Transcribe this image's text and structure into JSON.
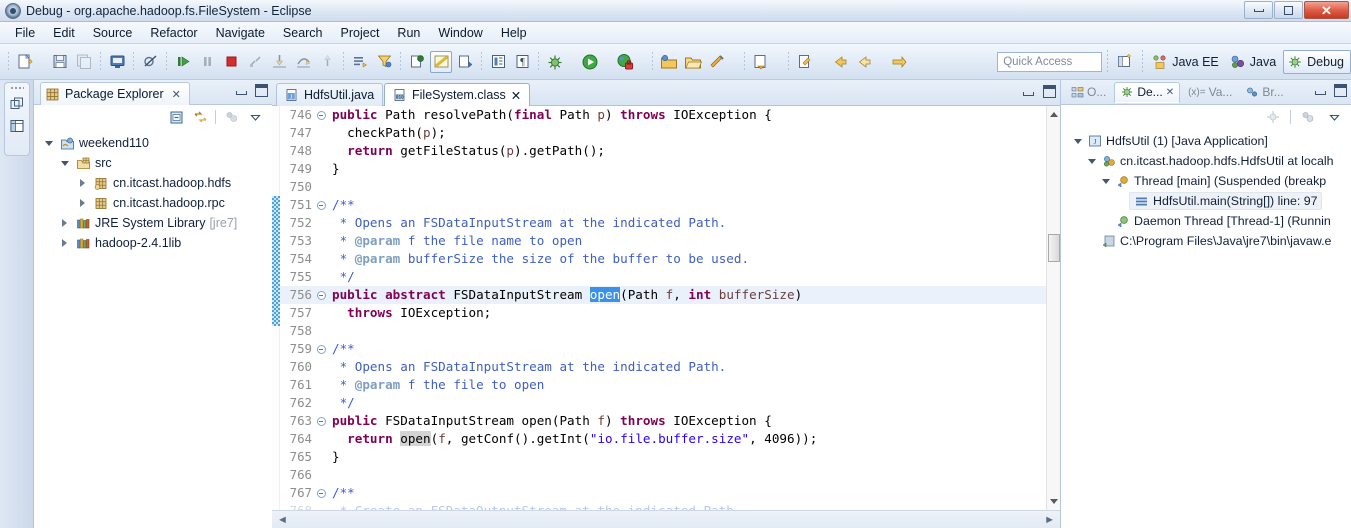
{
  "window": {
    "title": "Debug - org.apache.hadoop.fs.FileSystem - Eclipse",
    "app_icon": "eclipse-icon",
    "minimize_label": "Minimize",
    "restore_label": "Restore",
    "close_label": "Close"
  },
  "menu": {
    "items": [
      {
        "label": "File"
      },
      {
        "label": "Edit"
      },
      {
        "label": "Source"
      },
      {
        "label": "Refactor"
      },
      {
        "label": "Navigate"
      },
      {
        "label": "Search"
      },
      {
        "label": "Project"
      },
      {
        "label": "Run"
      },
      {
        "label": "Window"
      },
      {
        "label": "Help"
      }
    ]
  },
  "toolbar": {
    "icons": [
      "new-wizard-icon",
      "new-dropdown-icon",
      "save-icon",
      "save-all-icon",
      "print-icon",
      "toggle-breakpoint-icon",
      "resume-icon",
      "suspend-icon",
      "terminate-icon",
      "disconnect-icon",
      "step-into-icon",
      "step-over-icon",
      "step-return-icon",
      "drop-to-frame-icon",
      "use-step-filters-icon",
      "skip-all-breakpoints-icon",
      "toggle-mark-occurrences-icon",
      "open-type-icon",
      "toggle-block-selection-icon",
      "show-whitespace-icon",
      "debug-icon",
      "debug-dropdown-icon",
      "run-icon",
      "run-dropdown-icon",
      "coverage-icon",
      "coverage-dropdown-icon",
      "new-java-project-icon",
      "open-folder-icon",
      "external-tools-icon",
      "external-tools-dropdown-icon",
      "search-icon",
      "search-dropdown-icon",
      "last-edit-location-icon",
      "last-edit-dropdown-icon",
      "back-icon",
      "forward-icon",
      "forward-dropdown-icon",
      "next-annotation-icon",
      "next-annotation-dropdown-icon"
    ],
    "quick_access_placeholder": "Quick Access",
    "open-perspective-icon": "open-perspective-icon",
    "perspectives": [
      {
        "label": "Java EE",
        "icon": "java-ee-perspective-icon",
        "active": false
      },
      {
        "label": "Java",
        "icon": "java-perspective-icon",
        "active": false
      },
      {
        "label": "Debug",
        "icon": "debug-perspective-icon",
        "active": true
      }
    ]
  },
  "left_strip": {
    "icons": [
      "restore-view-icon",
      "package-explorer-fastview-icon"
    ]
  },
  "package_explorer": {
    "tab_label": "Package Explorer",
    "tab_icon": "package-explorer-icon",
    "close_glyph": "✕",
    "toolbar_icons": [
      "collapse-all-icon",
      "link-with-editor-icon",
      "focus-on-active-task-icon",
      "view-menu-icon"
    ],
    "tree": [
      {
        "label": "weekend110",
        "icon": "java-project-icon",
        "indent": 0,
        "twisty": "open"
      },
      {
        "label": "src",
        "icon": "source-folder-icon",
        "indent": 1,
        "twisty": "open"
      },
      {
        "label": "cn.itcast.hadoop.hdfs",
        "icon": "package-icon",
        "indent": 2,
        "twisty": "closed"
      },
      {
        "label": "cn.itcast.hadoop.rpc",
        "icon": "package-icon",
        "indent": 2,
        "twisty": "closed"
      },
      {
        "label": "JRE System Library",
        "suffix": "[jre7]",
        "icon": "library-icon",
        "indent": 1,
        "twisty": "closed"
      },
      {
        "label": "hadoop-2.4.1lib",
        "icon": "library-icon",
        "indent": 1,
        "twisty": "closed"
      }
    ]
  },
  "editor": {
    "tabs": [
      {
        "label": "HdfsUtil.java",
        "icon": "java-file-icon",
        "active": false,
        "closable": false
      },
      {
        "label": "FileSystem.class",
        "icon": "class-file-icon",
        "active": true,
        "closable": true,
        "close_glyph": "✕"
      }
    ],
    "controls": [
      "minimize-icon",
      "maximize-icon"
    ],
    "scroll": {
      "up_glyph": "▲",
      "down_glyph": "▼",
      "left_glyph": "◄",
      "right_glyph": "►"
    },
    "lines": [
      {
        "no": "746",
        "fold": true,
        "indent": 1,
        "tokens": [
          {
            "t": "public ",
            "c": "kw"
          },
          {
            "t": "Path resolvePath(",
            "c": ""
          },
          {
            "t": "final",
            "c": "kw"
          },
          {
            "t": " Path ",
            "c": ""
          },
          {
            "t": "p",
            "c": "par"
          },
          {
            "t": ") ",
            "c": ""
          },
          {
            "t": "throws",
            "c": "kw"
          },
          {
            "t": " IOException {",
            "c": ""
          }
        ]
      },
      {
        "no": "747",
        "fold": false,
        "indent": 1,
        "tokens": [
          {
            "t": "  checkPath(",
            "c": ""
          },
          {
            "t": "p",
            "c": "par"
          },
          {
            "t": ");",
            "c": ""
          }
        ]
      },
      {
        "no": "748",
        "fold": false,
        "indent": 1,
        "tokens": [
          {
            "t": "  ",
            "c": ""
          },
          {
            "t": "return",
            "c": "kw"
          },
          {
            "t": " getFileStatus(",
            "c": ""
          },
          {
            "t": "p",
            "c": "par"
          },
          {
            "t": ").getPath();",
            "c": ""
          }
        ]
      },
      {
        "no": "749",
        "fold": false,
        "indent": 1,
        "tokens": [
          {
            "t": "}",
            "c": ""
          }
        ]
      },
      {
        "no": "750",
        "fold": false,
        "indent": 1,
        "tokens": []
      },
      {
        "no": "751",
        "fold": true,
        "indent": 1,
        "tokens": [
          {
            "t": "/**",
            "c": "cmt"
          }
        ]
      },
      {
        "no": "752",
        "fold": false,
        "indent": 1,
        "tokens": [
          {
            "t": " * Opens an FSDataInputStream at the indicated Path.",
            "c": "cmt"
          }
        ]
      },
      {
        "no": "753",
        "fold": false,
        "indent": 1,
        "tokens": [
          {
            "t": " * ",
            "c": "cmt"
          },
          {
            "t": "@param",
            "c": "cmtk"
          },
          {
            "t": " f the file name to open",
            "c": "cmt"
          }
        ]
      },
      {
        "no": "754",
        "fold": false,
        "indent": 1,
        "tokens": [
          {
            "t": " * ",
            "c": "cmt"
          },
          {
            "t": "@param",
            "c": "cmtk"
          },
          {
            "t": " bufferSize the size of the buffer to be used.",
            "c": "cmt"
          }
        ]
      },
      {
        "no": "755",
        "fold": false,
        "indent": 1,
        "tokens": [
          {
            "t": " */",
            "c": "cmt"
          }
        ]
      },
      {
        "no": "756",
        "fold": true,
        "indent": 1,
        "highlight": true,
        "tokens": [
          {
            "t": "public abstract",
            "c": "kw"
          },
          {
            "t": " FSDataInputStream ",
            "c": ""
          },
          {
            "t": "open",
            "c": "sel"
          },
          {
            "t": "(Path ",
            "c": ""
          },
          {
            "t": "f",
            "c": "par"
          },
          {
            "t": ", ",
            "c": ""
          },
          {
            "t": "int",
            "c": "kw"
          },
          {
            "t": " ",
            "c": ""
          },
          {
            "t": "bufferSize",
            "c": "par"
          },
          {
            "t": ")",
            "c": ""
          }
        ]
      },
      {
        "no": "757",
        "fold": false,
        "indent": 1,
        "tokens": [
          {
            "t": "  ",
            "c": ""
          },
          {
            "t": "throws",
            "c": "kw"
          },
          {
            "t": " IOException;",
            "c": ""
          }
        ]
      },
      {
        "no": "758",
        "fold": false,
        "indent": 1,
        "tokens": []
      },
      {
        "no": "759",
        "fold": true,
        "indent": 1,
        "tokens": [
          {
            "t": "/**",
            "c": "cmt"
          }
        ]
      },
      {
        "no": "760",
        "fold": false,
        "indent": 1,
        "tokens": [
          {
            "t": " * Opens an FSDataInputStream at the indicated Path.",
            "c": "cmt"
          }
        ]
      },
      {
        "no": "761",
        "fold": false,
        "indent": 1,
        "tokens": [
          {
            "t": " * ",
            "c": "cmt"
          },
          {
            "t": "@param",
            "c": "cmtk"
          },
          {
            "t": " f the file to open",
            "c": "cmt"
          }
        ]
      },
      {
        "no": "762",
        "fold": false,
        "indent": 1,
        "tokens": [
          {
            "t": " */",
            "c": "cmt"
          }
        ]
      },
      {
        "no": "763",
        "fold": true,
        "indent": 1,
        "tokens": [
          {
            "t": "public",
            "c": "kw"
          },
          {
            "t": " FSDataInputStream open(Path ",
            "c": ""
          },
          {
            "t": "f",
            "c": "par"
          },
          {
            "t": ") ",
            "c": ""
          },
          {
            "t": "throws",
            "c": "kw"
          },
          {
            "t": " IOException {",
            "c": ""
          }
        ]
      },
      {
        "no": "764",
        "fold": false,
        "indent": 1,
        "tokens": [
          {
            "t": "  ",
            "c": ""
          },
          {
            "t": "return",
            "c": "kw"
          },
          {
            "t": " ",
            "c": ""
          },
          {
            "t": "open",
            "c": "occ"
          },
          {
            "t": "(",
            "c": ""
          },
          {
            "t": "f",
            "c": "par"
          },
          {
            "t": ", getConf().getInt(",
            "c": ""
          },
          {
            "t": "\"io.file.buffer.size\"",
            "c": "str"
          },
          {
            "t": ", 4096));",
            "c": ""
          }
        ]
      },
      {
        "no": "765",
        "fold": false,
        "indent": 1,
        "tokens": [
          {
            "t": "}",
            "c": ""
          }
        ]
      },
      {
        "no": "766",
        "fold": false,
        "indent": 1,
        "tokens": []
      },
      {
        "no": "767",
        "fold": true,
        "indent": 1,
        "tokens": [
          {
            "t": "/**",
            "c": "cmt"
          }
        ]
      },
      {
        "no": "768",
        "fold": false,
        "indent": 1,
        "clipped": true,
        "tokens": [
          {
            "t": " * Create an FSDataOutputStream at the indicated Path.",
            "c": "cmt"
          }
        ]
      }
    ]
  },
  "debug_view": {
    "tabs": [
      {
        "label": "O...",
        "icon": "outline-icon",
        "active": false
      },
      {
        "label": "De...",
        "icon": "debug-icon",
        "active": true,
        "closable": true,
        "close_glyph": "✕"
      },
      {
        "label": "Va...",
        "icon": "variables-icon",
        "prefix": "(x)=",
        "active": false
      },
      {
        "label": "Br...",
        "icon": "breakpoints-icon",
        "active": false
      }
    ],
    "controls": [
      "minimize-icon",
      "maximize-icon"
    ],
    "toolbar_icons": [
      "disconnect-icon",
      "remove-all-terminated-icon",
      "view-menu-icon"
    ],
    "tree": [
      {
        "label": "HdfsUtil (1) [Java Application]",
        "icon": "launch-config-icon",
        "indent": 0,
        "twisty": "open",
        "selected": false
      },
      {
        "label": "cn.itcast.hadoop.hdfs.HdfsUtil at localh",
        "icon": "debug-target-icon",
        "indent": 1,
        "twisty": "open",
        "selected": false
      },
      {
        "label": "Thread [main] (Suspended (breakp",
        "icon": "thread-suspended-icon",
        "indent": 2,
        "twisty": "open",
        "selected": false
      },
      {
        "label": "HdfsUtil.main(String[]) line: 97",
        "icon": "stack-frame-icon",
        "indent": 3,
        "twisty": "none",
        "selected": true
      },
      {
        "label": "Daemon Thread [Thread-1] (Runnin",
        "icon": "thread-running-icon",
        "indent": 2,
        "twisty": "none",
        "selected": false
      },
      {
        "label": "C:\\Program Files\\Java\\jre7\\bin\\javaw.e",
        "icon": "process-icon",
        "indent": 1,
        "twisty": "none",
        "selected": false
      }
    ]
  },
  "colors": {
    "keyword": "#7f0055",
    "comment": "#3f5fbf",
    "javadoc_tag": "#7f9fbf",
    "string": "#2a00ff",
    "parameter": "#6a3e3e",
    "selection": "#3c91e6",
    "occurrence": "#d4d4d4",
    "current_line": "#eaf1fb",
    "range_marker": "#4aa3e0"
  }
}
